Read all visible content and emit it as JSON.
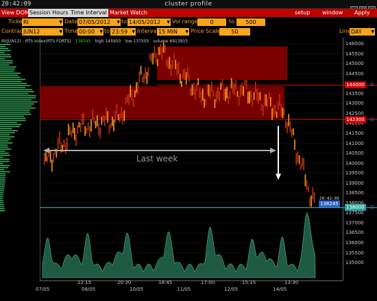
{
  "window": {
    "clock": "20:42:09",
    "title": "cluster profile"
  },
  "menubar": {
    "tabs": [
      "View DOM",
      "Session Hours",
      "Time Interval",
      "Market Watch"
    ],
    "right_items": [
      "setup",
      "window",
      "Apply"
    ]
  },
  "params": {
    "ticker_label": "Ticker",
    "ticker": "RI",
    "date_label": "Date",
    "date_from": "07/05/2012",
    "date_to_label": "to",
    "date_to": "14/05/2012",
    "vol_range_label": "Vol range",
    "vol_from": "0",
    "vol_to_label": "to",
    "vol_to": "500",
    "contract_label": "Contract",
    "contract": "JUN12",
    "time_label": "Time",
    "time_from": "00:00",
    "time_to_label": "to",
    "time_to": "23:59",
    "interval_label": "Interval",
    "interval": "15 MIN",
    "price_scale_label": "Price Scale",
    "price_scale": "50",
    "line_label": "Line",
    "line": "DAY"
  },
  "chart_info": {
    "symbol": "RI(JUN12) - RTS Index(RTS FORTS)",
    "last": "138245",
    "high": "high 145950",
    "low": "low 137550",
    "volume": "volume 6913915"
  },
  "annotation": "Last week",
  "price_tags": {
    "upper": "144000",
    "middle": "142300",
    "current": "138245",
    "lower": "138000",
    "marker": "D",
    "timestamp": "20:42:09"
  },
  "colors": {
    "menubar": "#c10000",
    "field": "#f7a51b",
    "label": "#f4a020",
    "zone": "#8b0000",
    "upper_line": "#d40000",
    "lower_line": "#2fa5a0",
    "current_tag": "#2a5ec8",
    "volume": "#2a7a5a"
  },
  "chart_data": {
    "type": "line",
    "y_axis_labels": [
      "146000",
      "145500",
      "145000",
      "144500",
      "144000",
      "143500",
      "143000",
      "142500",
      "142000",
      "141500",
      "141000",
      "140500",
      "140000",
      "139500",
      "139000",
      "138500",
      "138000",
      "137500",
      "137000",
      "136500",
      "136000",
      "135500",
      "135000"
    ],
    "x_axis_time_labels": [
      "22:15",
      "20:30",
      "18:45",
      "17:00",
      "15:15",
      "13:30"
    ],
    "x_axis_date_labels": [
      "07/05",
      "08/05",
      "10/05",
      "11/05",
      "12/05",
      "14/05"
    ],
    "ylim": [
      135000,
      146000
    ],
    "price_path": {
      "x_time_labels": [
        "07/05",
        "22:15",
        "20:30",
        "18:45",
        "17:00",
        "15:15",
        "13:30",
        "14/05"
      ],
      "y": [
        139900,
        141800,
        142200,
        145700,
        143400,
        143700,
        142500,
        138100
      ]
    },
    "zones": [
      {
        "from_price": 144200,
        "to_price": 145800,
        "label": ""
      },
      {
        "from_price": 142300,
        "to_price": 144000,
        "label": ""
      }
    ],
    "levels": [
      144000,
      142300,
      138000
    ]
  }
}
